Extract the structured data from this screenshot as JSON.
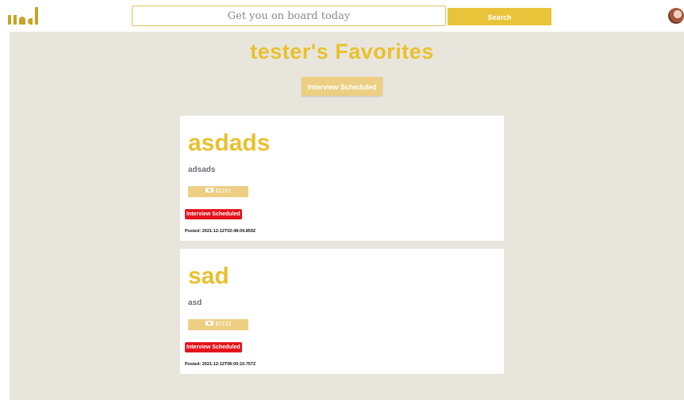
{
  "header": {
    "search_placeholder": "Get you on board today",
    "search_label": "Search"
  },
  "main": {
    "title": "tester's Favorites",
    "filter_label": "Interview Scheduled"
  },
  "jobs": [
    {
      "title": "asdads",
      "description": "adsads",
      "salary": "$1231",
      "status": "Interview Scheduled",
      "posted": "Posted: 2021-12-12T02:48:04.859Z"
    },
    {
      "title": "sad",
      "description": "asd",
      "salary": "$2133",
      "status": "Interview Scheduled",
      "posted": "Posted: 2021-12-12T06:00:10.757Z"
    }
  ],
  "colors": {
    "accent": "#e9c02f",
    "button": "#e9c43a",
    "muted_button": "#eccf83",
    "status_red": "#e5131b",
    "background": "#e8e6dc"
  },
  "icons": {
    "salary": "money-icon"
  }
}
